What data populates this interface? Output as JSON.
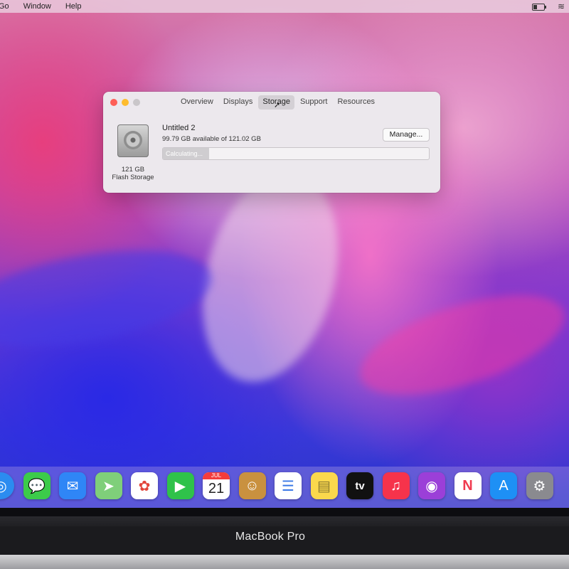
{
  "menubar": {
    "items": [
      "Go",
      "Window",
      "Help"
    ]
  },
  "window": {
    "tabs": [
      {
        "label": "Overview",
        "active": false
      },
      {
        "label": "Displays",
        "active": false
      },
      {
        "label": "Storage",
        "active": true
      },
      {
        "label": "Support",
        "active": false
      },
      {
        "label": "Resources",
        "active": false
      }
    ],
    "disk": {
      "size": "121 GB",
      "type": "Flash Storage",
      "icon": "hard-drive-icon"
    },
    "volume": {
      "name": "Untitled 2",
      "available": "99.79 GB available of 121.02 GB",
      "status": "Calculating...",
      "used_fraction": 0.175
    },
    "manage_label": "Manage..."
  },
  "dock": {
    "icons": [
      {
        "name": "safari-icon",
        "color": "#2b8cf0",
        "glyph": "◎"
      },
      {
        "name": "messages-icon",
        "color": "#3ccb4a",
        "glyph": "💬"
      },
      {
        "name": "mail-icon",
        "color": "#2f86f6",
        "glyph": "✉"
      },
      {
        "name": "maps-icon",
        "color": "#7fcf7a",
        "glyph": "➤"
      },
      {
        "name": "photos-icon",
        "color": "#ffffff",
        "glyph": "✿"
      },
      {
        "name": "facetime-icon",
        "color": "#2fc24a",
        "glyph": "▶"
      },
      {
        "name": "calendar-icon",
        "color": "#ffffff",
        "month": "JUL",
        "day": "21"
      },
      {
        "name": "contacts-icon",
        "color": "#c9913f",
        "glyph": "☺"
      },
      {
        "name": "reminders-icon",
        "color": "#ffffff",
        "glyph": "☰"
      },
      {
        "name": "notes-icon",
        "color": "#fbd84c",
        "glyph": "▤"
      },
      {
        "name": "apple-tv-icon",
        "color": "#111111",
        "label": "tv"
      },
      {
        "name": "music-icon",
        "color": "#f6334b",
        "glyph": "♫"
      },
      {
        "name": "podcasts-icon",
        "color": "#9b3fd8",
        "glyph": "◉"
      },
      {
        "name": "news-icon",
        "color": "#ffffff",
        "glyph": "N"
      },
      {
        "name": "app-store-icon",
        "color": "#1e90f5",
        "glyph": "A"
      },
      {
        "name": "system-preferences-icon",
        "color": "#8a8a8f",
        "glyph": "⚙"
      }
    ]
  },
  "device": {
    "model": "MacBook Pro"
  }
}
